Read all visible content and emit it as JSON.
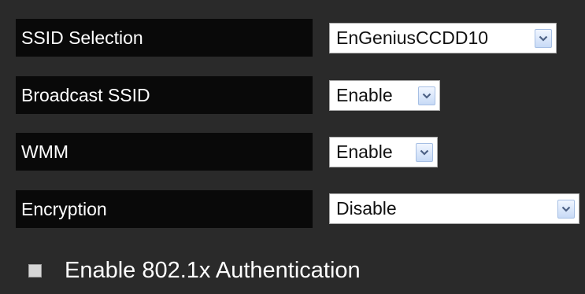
{
  "settings": {
    "ssid_selection": {
      "label": "SSID Selection",
      "value": "EnGeniusCCDD10"
    },
    "broadcast_ssid": {
      "label": "Broadcast SSID",
      "value": "Enable"
    },
    "wmm": {
      "label": "WMM",
      "value": "Enable"
    },
    "encryption": {
      "label": "Encryption",
      "value": "Disable"
    }
  },
  "auth_8021x": {
    "label": "Enable 802.1x Authentication",
    "checked": false
  },
  "icons": {
    "dropdown": "chevron-down-icon"
  }
}
